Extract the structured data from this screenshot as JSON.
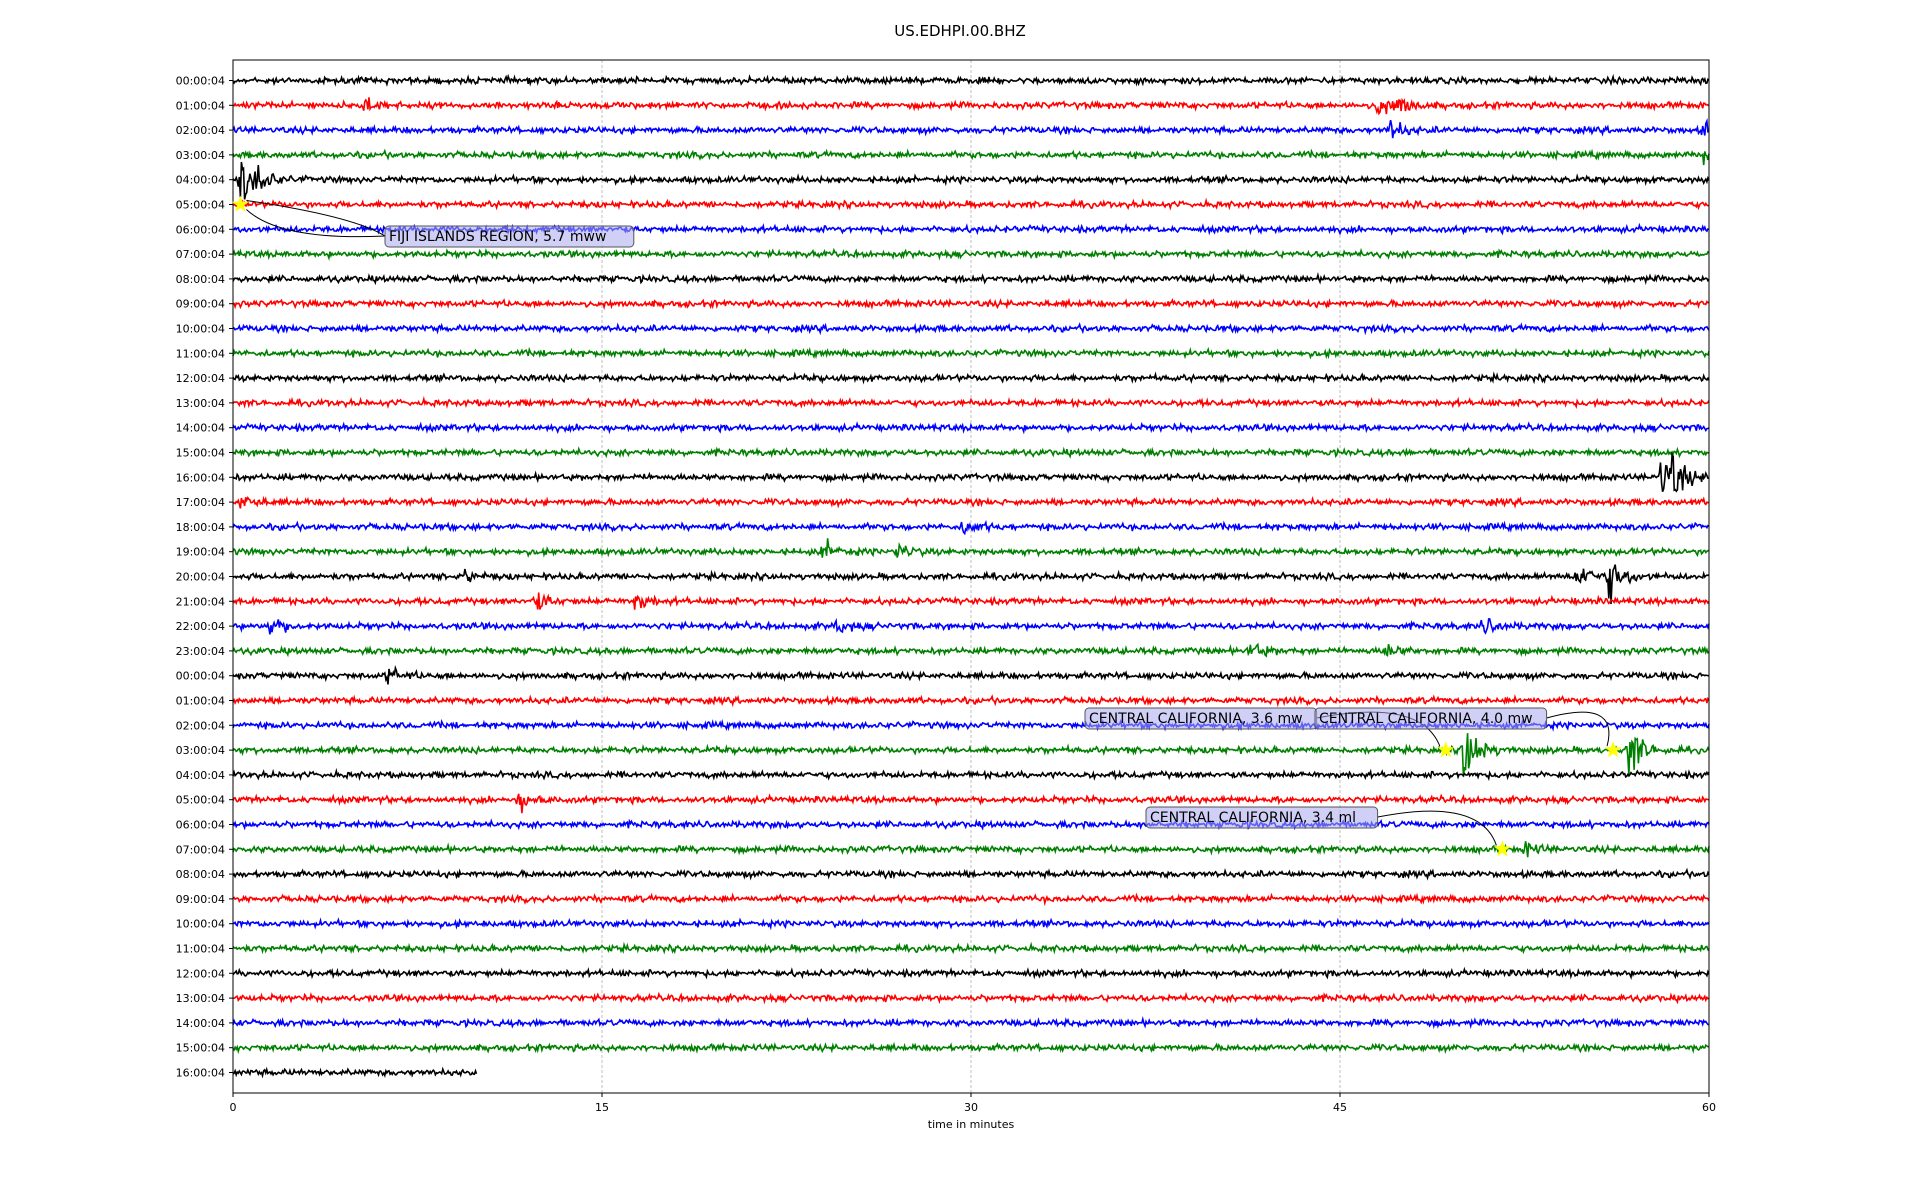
{
  "chart_data": {
    "type": "line",
    "title": "US.EDHPI.00.BHZ",
    "xlabel": "time in minutes",
    "ylabel": "",
    "xlim": [
      0,
      60
    ],
    "xticks": [
      0,
      15,
      30,
      45,
      60
    ],
    "grid": "vertical",
    "row_labels": [
      "00:00:04",
      "01:00:04",
      "02:00:04",
      "03:00:04",
      "04:00:04",
      "05:00:04",
      "06:00:04",
      "07:00:04",
      "08:00:04",
      "09:00:04",
      "10:00:04",
      "11:00:04",
      "12:00:04",
      "13:00:04",
      "14:00:04",
      "15:00:04",
      "16:00:04",
      "17:00:04",
      "18:00:04",
      "19:00:04",
      "20:00:04",
      "21:00:04",
      "22:00:04",
      "23:00:04",
      "00:00:04",
      "01:00:04",
      "02:00:04",
      "03:00:04",
      "04:00:04",
      "05:00:04",
      "06:00:04",
      "07:00:04",
      "08:00:04",
      "09:00:04",
      "10:00:04",
      "11:00:04",
      "12:00:04",
      "13:00:04",
      "14:00:04",
      "15:00:04",
      "16:00:04"
    ],
    "colors": [
      "#000000",
      "#ff0000",
      "#0000ff",
      "#008000"
    ],
    "last_row_end_minute": 9.9,
    "bursts": [
      {
        "row": 1,
        "minute": 5.3,
        "amp": 1.5
      },
      {
        "row": 1,
        "minute": 46.5,
        "amp": 2
      },
      {
        "row": 1,
        "minute": 47.3,
        "amp": 2
      },
      {
        "row": 2,
        "minute": 47.0,
        "amp": 2
      },
      {
        "row": 2,
        "minute": 59.8,
        "amp": 1.5
      },
      {
        "row": 3,
        "minute": 59.7,
        "amp": 1.5
      },
      {
        "row": 4,
        "minute": 0.3,
        "amp": 5
      },
      {
        "row": 4,
        "minute": 1.0,
        "amp": 2
      },
      {
        "row": 16,
        "minute": 58.0,
        "amp": 5
      },
      {
        "row": 16,
        "minute": 58.5,
        "amp": 3
      },
      {
        "row": 17,
        "minute": 0.3,
        "amp": 1.5
      },
      {
        "row": 18,
        "minute": 29.7,
        "amp": 1.5
      },
      {
        "row": 19,
        "minute": 24.0,
        "amp": 2
      },
      {
        "row": 19,
        "minute": 27.0,
        "amp": 1.5
      },
      {
        "row": 20,
        "minute": 54.6,
        "amp": 3
      },
      {
        "row": 20,
        "minute": 55.9,
        "amp": 5
      },
      {
        "row": 20,
        "minute": 9.3,
        "amp": 1.3
      },
      {
        "row": 21,
        "minute": 12.3,
        "amp": 2
      },
      {
        "row": 21,
        "minute": 16.3,
        "amp": 2
      },
      {
        "row": 22,
        "minute": 1.5,
        "amp": 2
      },
      {
        "row": 22,
        "minute": 24.5,
        "amp": 1.5
      },
      {
        "row": 22,
        "minute": 50.8,
        "amp": 1.5
      },
      {
        "row": 23,
        "minute": 41.3,
        "amp": 1.8
      },
      {
        "row": 23,
        "minute": 46.8,
        "amp": 1.5
      },
      {
        "row": 24,
        "minute": 6.3,
        "amp": 1.5
      },
      {
        "row": 27,
        "minute": 50.0,
        "amp": 8
      },
      {
        "row": 27,
        "minute": 56.7,
        "amp": 6
      },
      {
        "row": 29,
        "minute": 11.6,
        "amp": 2
      },
      {
        "row": 31,
        "minute": 52.5,
        "amp": 1.3
      }
    ],
    "events": [
      {
        "label": "FIJI ISLANDS REGION, 5.7 mww",
        "row": 5,
        "minute": 0.3
      },
      {
        "label": "CENTRAL CALIFORNIA, 3.6 mw",
        "row": 27,
        "minute": 49.3
      },
      {
        "label": "CENTRAL CALIFORNIA, 4.0 mw",
        "row": 27,
        "minute": 56.1
      },
      {
        "label": "CENTRAL CALIFORNIA, 3.4 ml",
        "row": 31,
        "minute": 51.6
      }
    ]
  }
}
